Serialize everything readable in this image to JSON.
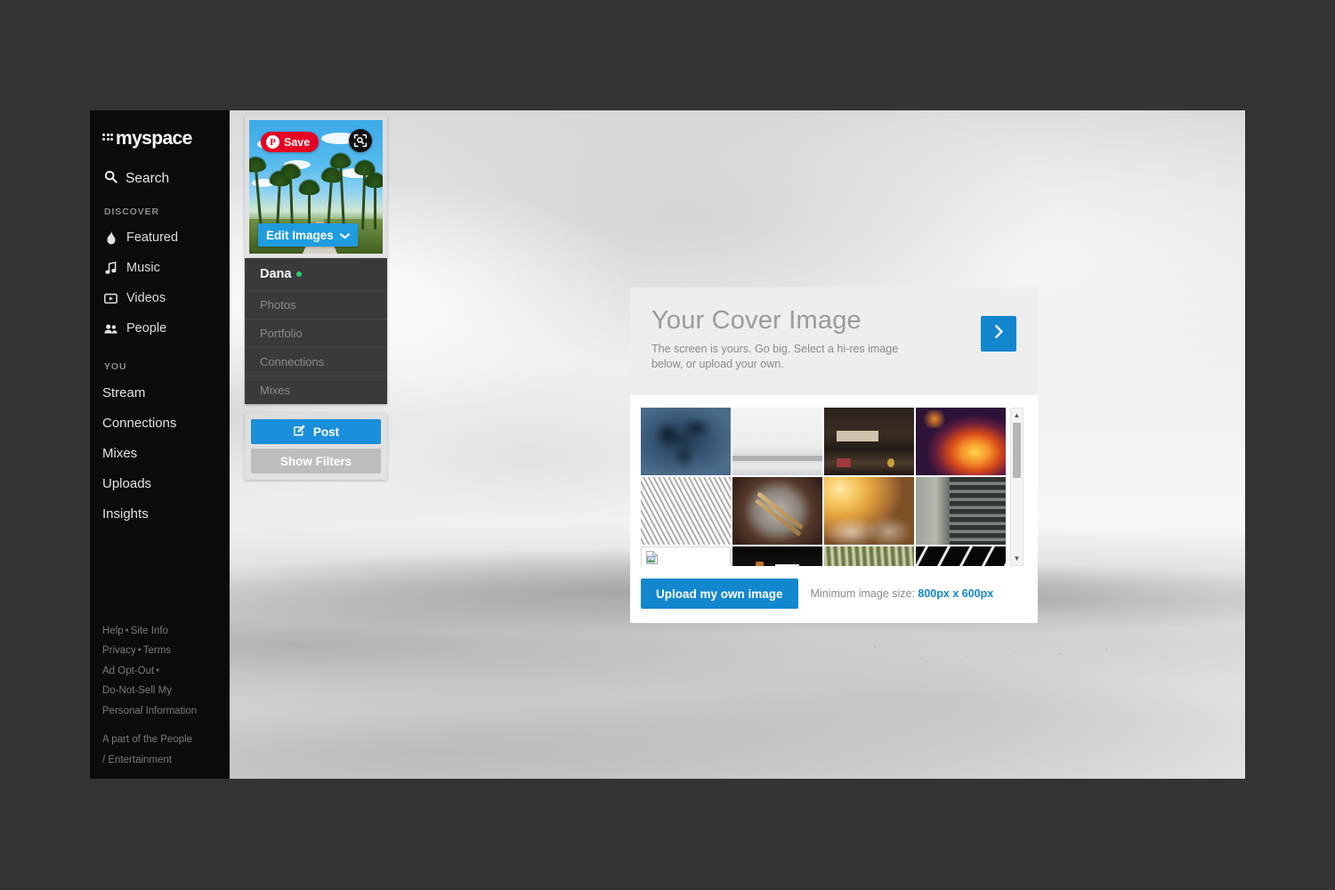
{
  "brand": {
    "name": "myspace"
  },
  "sidebar": {
    "search_label": "Search",
    "discover_header": "DISCOVER",
    "discover_items": [
      {
        "label": "Featured",
        "icon": "flame-icon"
      },
      {
        "label": "Music",
        "icon": "music-note-icon"
      },
      {
        "label": "Videos",
        "icon": "video-icon"
      },
      {
        "label": "People",
        "icon": "people-icon"
      }
    ],
    "you_header": "YOU",
    "you_items": [
      {
        "label": "Stream"
      },
      {
        "label": "Connections"
      },
      {
        "label": "Mixes"
      },
      {
        "label": "Uploads"
      },
      {
        "label": "Insights"
      }
    ],
    "footer": {
      "help": "Help",
      "site_info": "Site Info",
      "privacy": "Privacy",
      "terms": "Terms",
      "ad_opt_out": "Ad Opt-Out",
      "do_not_sell_line1": "Do-Not-Sell My",
      "do_not_sell_line2": "Personal Information",
      "attribution_line1": "A part of the People",
      "attribution_line2": "/ Entertainment",
      "bullet": "•"
    }
  },
  "profile": {
    "pinterest_save_label": "Save",
    "pinterest_logo_glyph": "P",
    "lens_icon": "visual-search-icon",
    "edit_images_label": "Edit Images",
    "name": "Dana",
    "online_status": "online",
    "meta_links": [
      {
        "label": "Photos"
      },
      {
        "label": "Portfolio"
      },
      {
        "label": "Connections"
      },
      {
        "label": "Mixes"
      }
    ],
    "post_label": "Post",
    "show_filters_label": "Show Filters"
  },
  "picker": {
    "title": "Your Cover Image",
    "subtitle": "The screen is yours. Go big. Select a hi-res image below, or upload your own.",
    "next_icon": "chevron-right-icon",
    "upload_label": "Upload my own image",
    "min_size_prefix": "Minimum image size:",
    "min_size_value": "800px x 600px",
    "scrollbar": {
      "up_icon": "caret-up-icon",
      "down_icon": "caret-down-icon"
    },
    "thumbnails": [
      {
        "name": "blue-ice-texture",
        "broken": false
      },
      {
        "name": "snow-field-horizon",
        "broken": false
      },
      {
        "name": "dark-workbench-shelf",
        "broken": false
      },
      {
        "name": "orange-fire-burst",
        "broken": false
      },
      {
        "name": "grey-steel-structure",
        "broken": false
      },
      {
        "name": "drum-with-sticks",
        "broken": false
      },
      {
        "name": "golden-sunburst-cattle",
        "broken": false
      },
      {
        "name": "concrete-building-facade",
        "broken": false
      },
      {
        "name": "missing-image-placeholder",
        "broken": true
      },
      {
        "name": "dark-doorway-light",
        "broken": false
      },
      {
        "name": "green-grass-blades",
        "broken": false
      },
      {
        "name": "white-curves-on-black",
        "broken": false
      }
    ]
  },
  "colors": {
    "accent_blue": "#1287ce",
    "post_blue": "#1a8fdb",
    "pinterest_red": "#e60023",
    "sidebar_black": "#0b0b0b",
    "online_green": "#2ecc71"
  }
}
